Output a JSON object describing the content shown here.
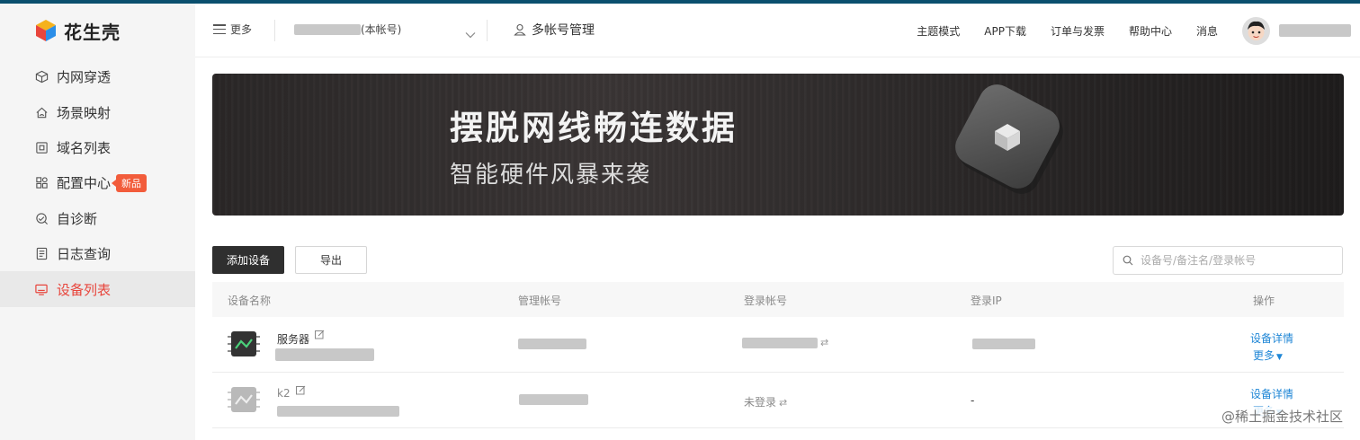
{
  "app": {
    "logo_text": "花生壳",
    "brand_color": "#e8453c"
  },
  "sidebar": {
    "items": [
      {
        "label": "内网穿透",
        "icon": "cube-icon",
        "active": false
      },
      {
        "label": "场景映射",
        "icon": "home-cloud-icon",
        "active": false
      },
      {
        "label": "域名列表",
        "icon": "domain-icon",
        "active": false
      },
      {
        "label": "配置中心",
        "icon": "grid-icon",
        "active": false,
        "badge": "新品"
      },
      {
        "label": "自诊断",
        "icon": "diagnose-icon",
        "active": false
      },
      {
        "label": "日志查询",
        "icon": "log-icon",
        "active": false
      },
      {
        "label": "设备列表",
        "icon": "monitor-icon",
        "active": true
      }
    ]
  },
  "header": {
    "more_label": "更多",
    "account_suffix": "(本帐号)",
    "multi_account_label": "多帐号管理",
    "links": [
      "主题模式",
      "APP下载",
      "订单与发票",
      "帮助中心",
      "消息"
    ]
  },
  "banner": {
    "title": "摆脱网线畅连数据",
    "subtitle": "智能硬件风暴来袭"
  },
  "toolbar": {
    "add_label": "添加设备",
    "export_label": "导出",
    "search_placeholder": "设备号/备注名/登录帐号"
  },
  "table": {
    "columns": [
      "设备名称",
      "管理帐号",
      "登录帐号",
      "登录IP",
      "操作"
    ],
    "rows": [
      {
        "name": "服务器",
        "login": "",
        "ip": "",
        "online": true,
        "action_detail": "设备详情",
        "action_more": "更多"
      },
      {
        "name": "k2",
        "login": "未登录",
        "ip": "-",
        "online": false,
        "action_detail": "设备详情",
        "action_more": "更多"
      }
    ]
  },
  "watermark": "@稀土掘金技术社区"
}
